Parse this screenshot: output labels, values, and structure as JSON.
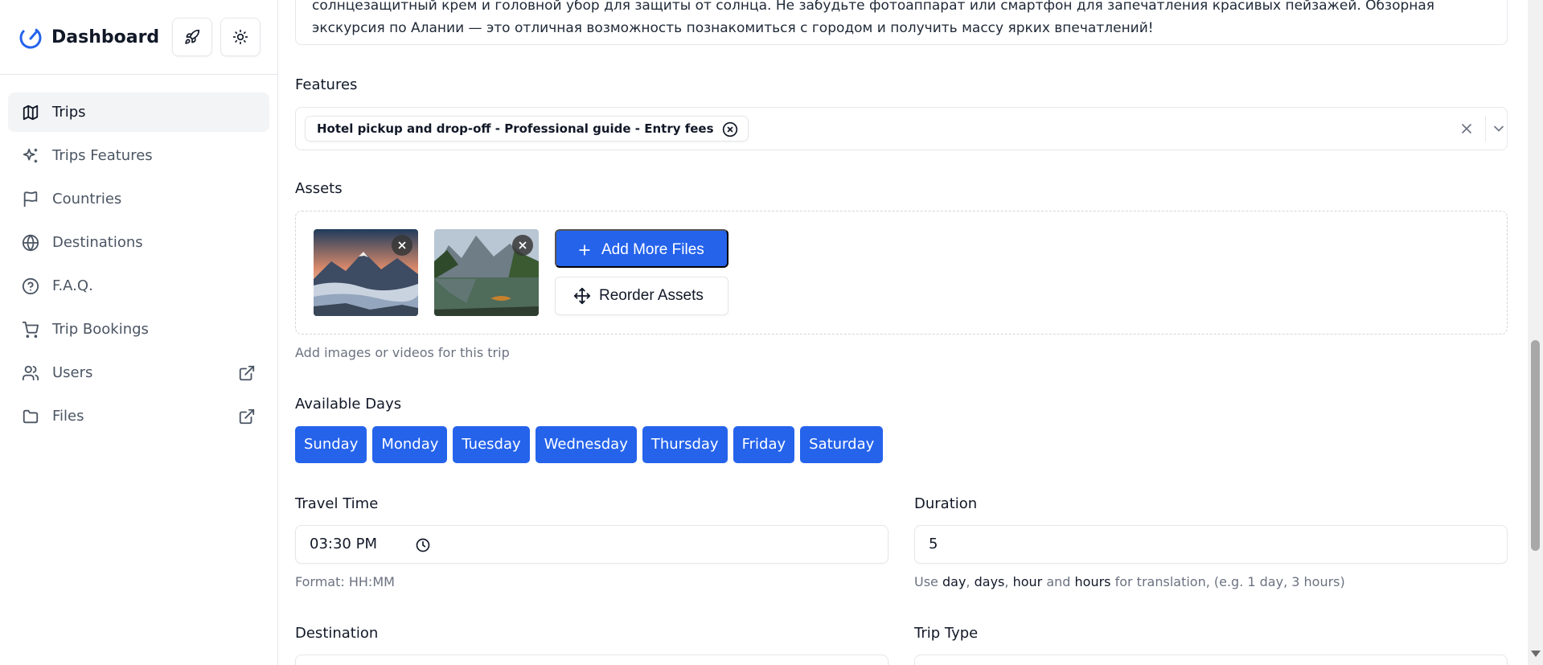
{
  "sidebar": {
    "title": "Dashboard",
    "items": [
      {
        "label": "Trips",
        "icon": "map-icon",
        "active": true
      },
      {
        "label": "Trips Features",
        "icon": "sparkles-icon"
      },
      {
        "label": "Countries",
        "icon": "flag-icon"
      },
      {
        "label": "Destinations",
        "icon": "globe-icon"
      },
      {
        "label": "F.A.Q.",
        "icon": "help-circle-icon"
      },
      {
        "label": "Trip Bookings",
        "icon": "cart-icon"
      },
      {
        "label": "Users",
        "icon": "users-icon",
        "external": true
      },
      {
        "label": "Files",
        "icon": "folder-icon",
        "external": true
      }
    ]
  },
  "description": {
    "text": "солнцезащитный крем и головной убор для защиты от солнца. Не забудьте фотоаппарат или смартфон для запечатления красивых пейзажей. Обзорная экскурсия по Алании — это отличная возможность познакомиться с городом и получить массу ярких впечатлений!"
  },
  "features": {
    "label": "Features",
    "selected": "Hotel pickup and drop-off - Professional guide - Entry fees"
  },
  "assets": {
    "label": "Assets",
    "add_button": "Add More Files",
    "reorder_button": "Reorder Assets",
    "help": "Add images or videos for this trip"
  },
  "available_days": {
    "label": "Available Days",
    "days": [
      "Sunday",
      "Monday",
      "Tuesday",
      "Wednesday",
      "Thursday",
      "Friday",
      "Saturday"
    ]
  },
  "travel_time": {
    "label": "Travel Time",
    "value": "03:30 PM",
    "help": "Format: HH:MM"
  },
  "duration": {
    "label": "Duration",
    "value": "5",
    "help": {
      "prefix": "Use",
      "w1": "day",
      "sep1": ",",
      "w2": "days",
      "sep2": ",",
      "w3": "hour",
      "and": "and",
      "w4": "hours",
      "suffix": "for translation, (e.g. 1 day, 3 hours)"
    }
  },
  "destination": {
    "label": "Destination"
  },
  "trip_type": {
    "label": "Trip Type"
  },
  "colors": {
    "primary": "#2563eb",
    "border": "#e5e7eb",
    "muted": "#6b7280"
  }
}
